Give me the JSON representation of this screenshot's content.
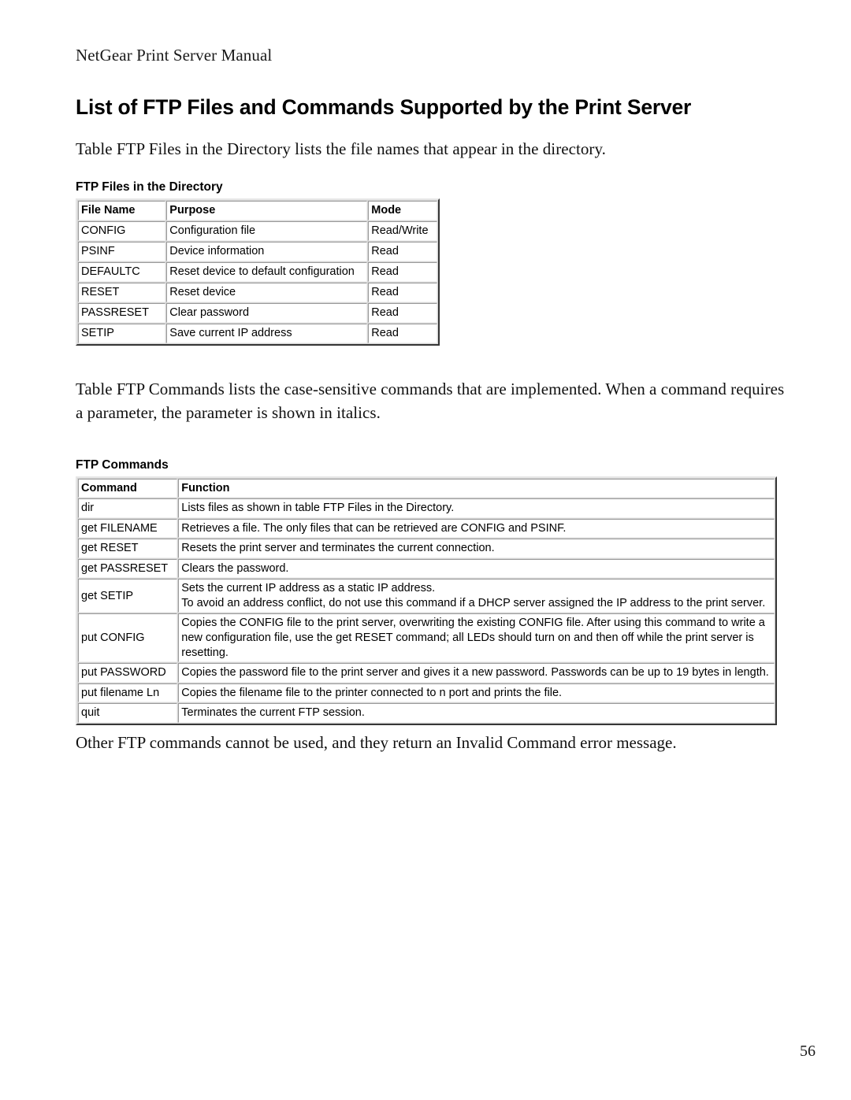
{
  "document": {
    "running_header": "NetGear Print Server Manual",
    "title": "List of FTP Files and Commands Supported by the Print Server",
    "intro_paragraph": "Table FTP Files in the Directory lists the file names that appear in the directory.",
    "second_paragraph": "Table FTP Commands lists the case-sensitive commands that are implemented. When a command requires a parameter, the parameter is shown in italics.",
    "closing_paragraph": "Other FTP commands cannot be used, and they return an Invalid Command error message.",
    "page_number": "56"
  },
  "table_ftp_files": {
    "caption": "FTP Files in the Directory",
    "headers": {
      "file_name": "File Name",
      "purpose": "Purpose",
      "mode": "Mode"
    },
    "rows": [
      {
        "file_name": "CONFIG",
        "purpose": "Configuration file",
        "mode": "Read/Write"
      },
      {
        "file_name": "PSINF",
        "purpose": "Device information",
        "mode": "Read"
      },
      {
        "file_name": "DEFAULTC",
        "purpose": "Reset device to default configuration",
        "mode": "Read"
      },
      {
        "file_name": "RESET",
        "purpose": "Reset device",
        "mode": "Read"
      },
      {
        "file_name": "PASSRESET",
        "purpose": "Clear password",
        "mode": "Read"
      },
      {
        "file_name": "SETIP",
        "purpose": "Save current IP address",
        "mode": "Read"
      }
    ]
  },
  "table_ftp_commands": {
    "caption": "FTP Commands",
    "headers": {
      "command": "Command",
      "function": "Function"
    },
    "rows": [
      {
        "command": "dir",
        "function": "Lists files as shown in table FTP Files in the Directory."
      },
      {
        "command": "get FILENAME",
        "function": "Retrieves a file. The only files that can be retrieved are CONFIG and PSINF."
      },
      {
        "command": "get RESET",
        "function": "Resets the print server and terminates the current connection."
      },
      {
        "command": "get PASSRESET",
        "function": "Clears the password."
      },
      {
        "command": "get SETIP",
        "function": "Sets the current IP address as a static IP address.\nTo avoid an address conflict, do not use this command if a DHCP server assigned the IP address to the print server."
      },
      {
        "command": "put CONFIG",
        "function": "Copies the CONFIG file to the print server, overwriting the existing CONFIG file. After using this command to write a new configuration file, use the get RESET command; all LEDs should turn on and then off while the print server is resetting."
      },
      {
        "command": "put PASSWORD",
        "function": "Copies the password file to the print server and gives it a new password. Passwords can be up to 19 bytes in length."
      },
      {
        "command": "put filename Ln",
        "function": "Copies the filename file to the printer connected to n port and prints the file."
      },
      {
        "command": "quit",
        "function": "Terminates the current FTP session."
      }
    ]
  }
}
